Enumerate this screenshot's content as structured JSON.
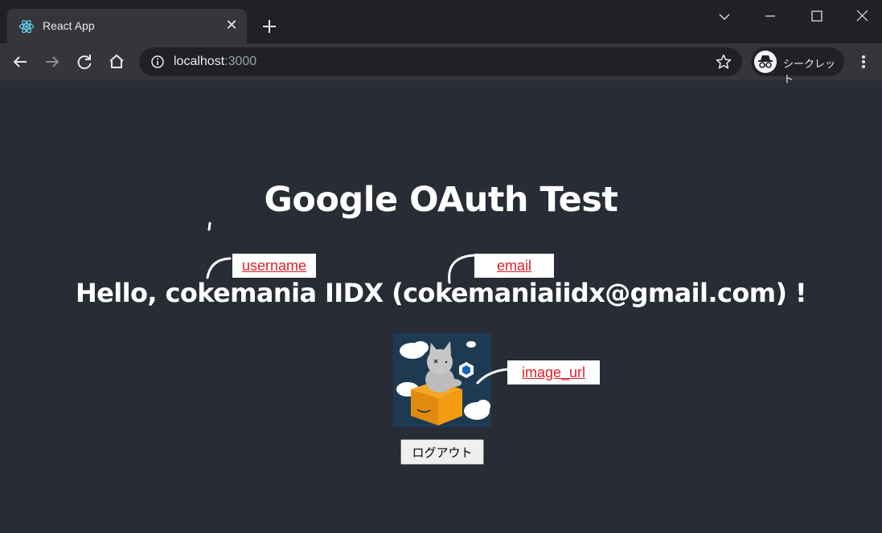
{
  "browser": {
    "tab_title": "React App",
    "url_host": "localhost",
    "url_port": ":3000",
    "profile_label": "シークレット"
  },
  "page": {
    "title": "Google OAuth Test",
    "greeting": "Hello, cokemania IIDX (cokemaniaiidx@gmail.com) !",
    "logout_label": "ログアウト"
  },
  "annotations": {
    "username": "username",
    "email": "email",
    "image_url": "image_url"
  },
  "colors": {
    "page_background": "#282c34",
    "annotation_text": "#e0202a",
    "react_logo": "#61dafb"
  },
  "icons": {
    "favicon": "react-logo-icon",
    "back": "arrow-left-icon",
    "forward": "arrow-right-icon",
    "reload": "reload-icon",
    "home": "home-icon",
    "site_info": "info-icon",
    "bookmark": "star-icon",
    "incognito": "incognito-icon",
    "menu": "kebab-menu-icon"
  }
}
